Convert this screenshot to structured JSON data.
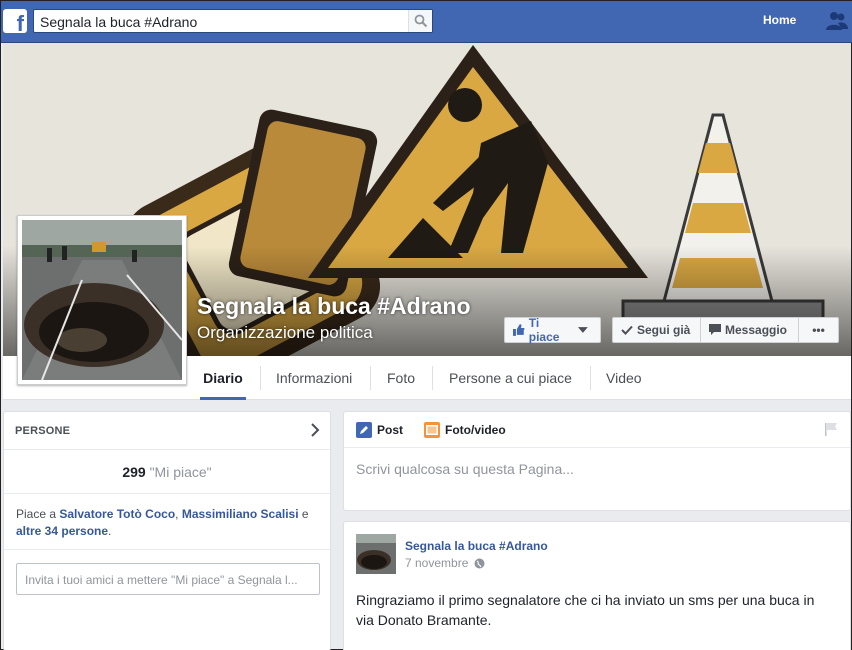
{
  "topbar": {
    "logo_letter": "f",
    "search_value": "Segnala la buca  #Adrano",
    "home_label": "Home",
    "brand_color": "#4267b2"
  },
  "page": {
    "name": "Segnala la buca #Adrano",
    "category": "Organizzazione politica"
  },
  "actions": {
    "like_label": "Ti piace",
    "follow_label": "Segui già",
    "message_label": "Messaggio",
    "more_label": "•••"
  },
  "tabs": [
    {
      "label": "Diario"
    },
    {
      "label": "Informazioni"
    },
    {
      "label": "Foto"
    },
    {
      "label": "Persone a cui piace"
    },
    {
      "label": "Video"
    }
  ],
  "people": {
    "title": "PERSONE",
    "likes_count": "299",
    "likes_label": "\"Mi piace\"",
    "friends_prefix": "Piace a ",
    "friend1": "Salvatore Totò Coco",
    "sep1": ", ",
    "friend2": "Massimiliano Scalisi",
    "sep2": " e ",
    "others": "altre 34 persone",
    "suffix": ".",
    "invite_placeholder": "Invita i tuoi amici a mettere \"Mi piace\" a Segnala l..."
  },
  "composer": {
    "tab_post": "Post",
    "tab_photo": "Foto/video",
    "placeholder": "Scrivi qualcosa su questa Pagina..."
  },
  "post": {
    "author": "Segnala la buca #Adrano",
    "date": "7 novembre",
    "text": "Ringraziamo il primo segnalatore che ci ha inviato un sms per una buca in via Donato Bramante."
  }
}
